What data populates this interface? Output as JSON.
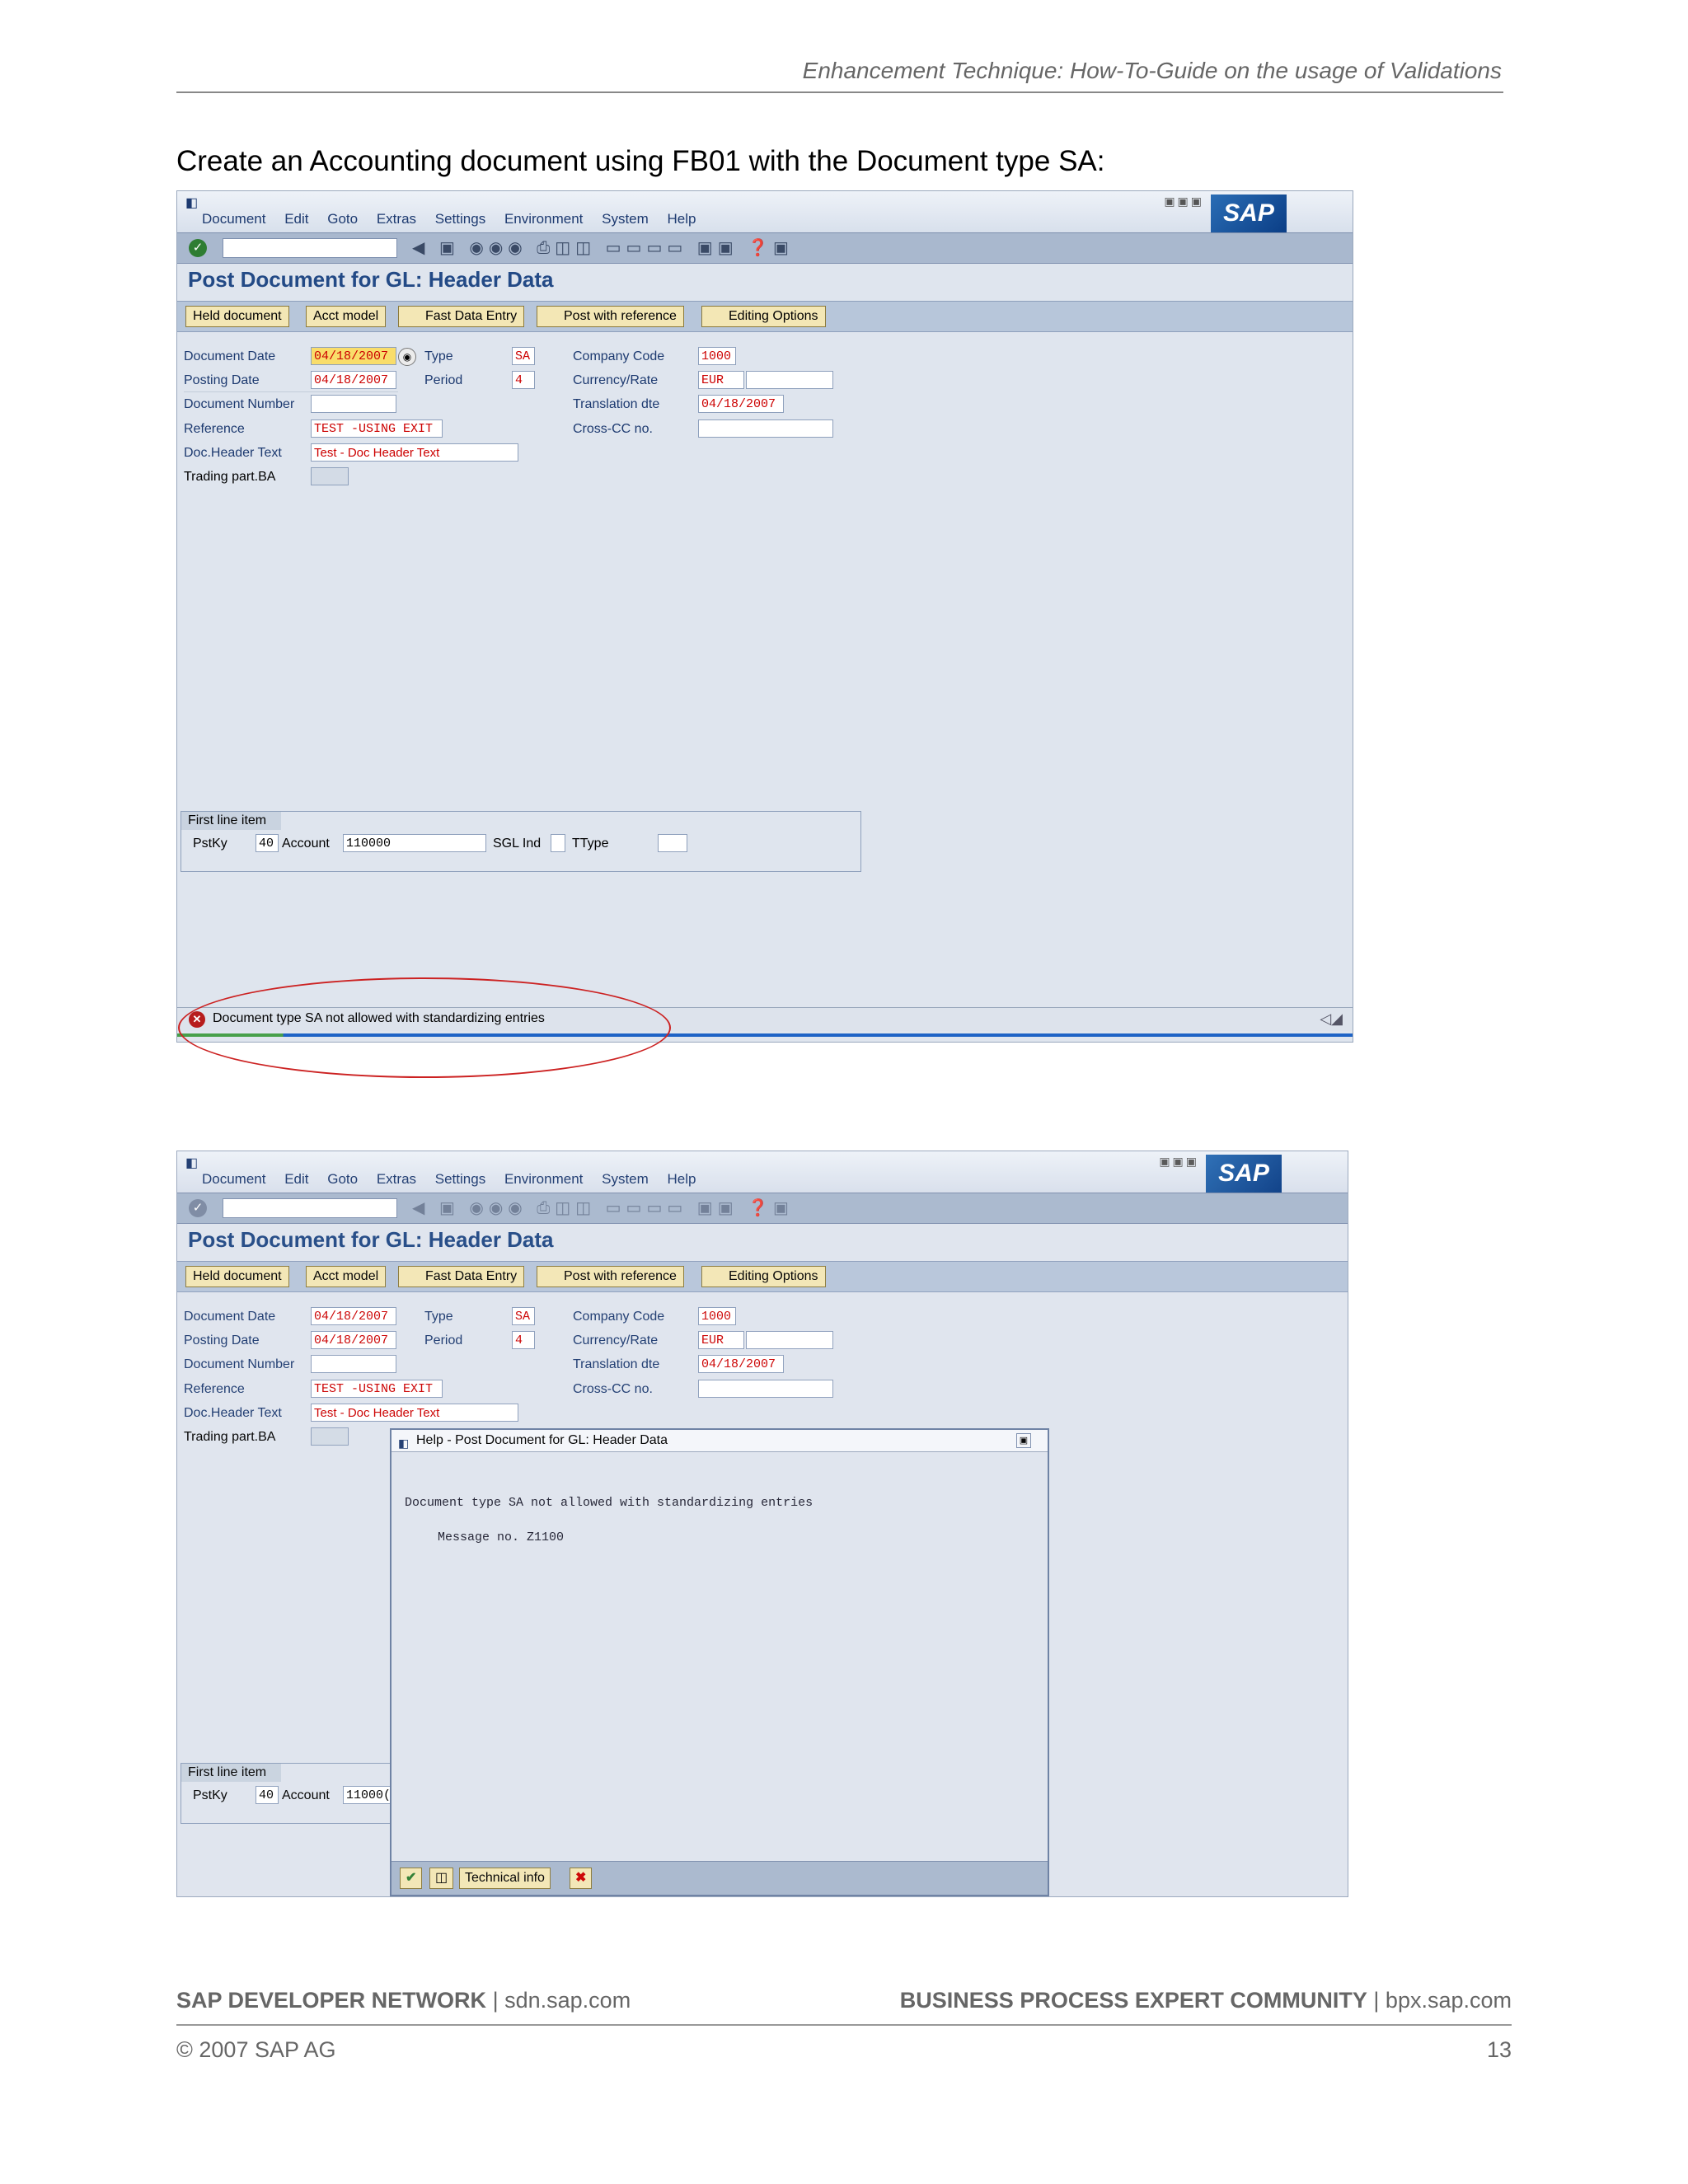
{
  "doc_header": "Enhancement Technique: How-To-Guide on the usage of Validations",
  "intro": "Create an Accounting document using FB01 with the Document type SA:",
  "sap": {
    "logo": "SAP",
    "menu": [
      "Document",
      "Edit",
      "Goto",
      "Extras",
      "Settings",
      "Environment",
      "System",
      "Help"
    ],
    "title": "Post Document for GL: Header Data",
    "app_buttons": [
      "Held document",
      "Acct model",
      "Fast Data Entry",
      "Post with reference",
      "Editing Options"
    ],
    "labels": {
      "document_date": "Document Date",
      "posting_date": "Posting Date",
      "document_number": "Document Number",
      "reference": "Reference",
      "doc_header_text": "Doc.Header Text",
      "trading_part_ba": "Trading part.BA",
      "type": "Type",
      "period": "Period",
      "company_code": "Company Code",
      "currency_rate": "Currency/Rate",
      "translation_dte": "Translation dte",
      "cross_cc_no": "Cross-CC no."
    },
    "values": {
      "document_date": "04/18/2007",
      "posting_date": "04/18/2007",
      "document_number": "",
      "reference": "TEST -USING EXIT",
      "doc_header_text": "Test - Doc Header Text",
      "trading_part_ba": "",
      "type": "SA",
      "period": "4",
      "company_code": "1000",
      "currency": "EUR",
      "rate": "",
      "translation_dte": "04/18/2007",
      "cross_cc_no": ""
    },
    "first_line_item": {
      "title": "First line item",
      "pstky_label": "PstKy",
      "pstky": "40",
      "account_label": "Account",
      "account": "110000",
      "account_short": "11000(",
      "sgl_ind_label": "SGL Ind",
      "sgl_ind": "",
      "ttype_label": "TType",
      "ttype": ""
    },
    "status_message": "Document type SA not allowed with standardizing entries"
  },
  "dialog": {
    "title": "Help - Post Document for GL: Header Data",
    "message": "Document type SA not allowed with standardizing entries",
    "message_no": "Message no. Z1100",
    "technical_info": "Technical info"
  },
  "footer": {
    "left_bold": "SAP DEVELOPER NETWORK",
    "left_url": "sdn.sap.com",
    "right_bold": "BUSINESS PROCESS EXPERT COMMUNITY",
    "right_url": "bpx.sap.com",
    "separator": "|",
    "copyright": "© 2007 SAP AG",
    "page": "13"
  },
  "colors": {
    "sap_title": "#234a86",
    "error_red": "#cc2222",
    "field_value": "#cc0000"
  }
}
